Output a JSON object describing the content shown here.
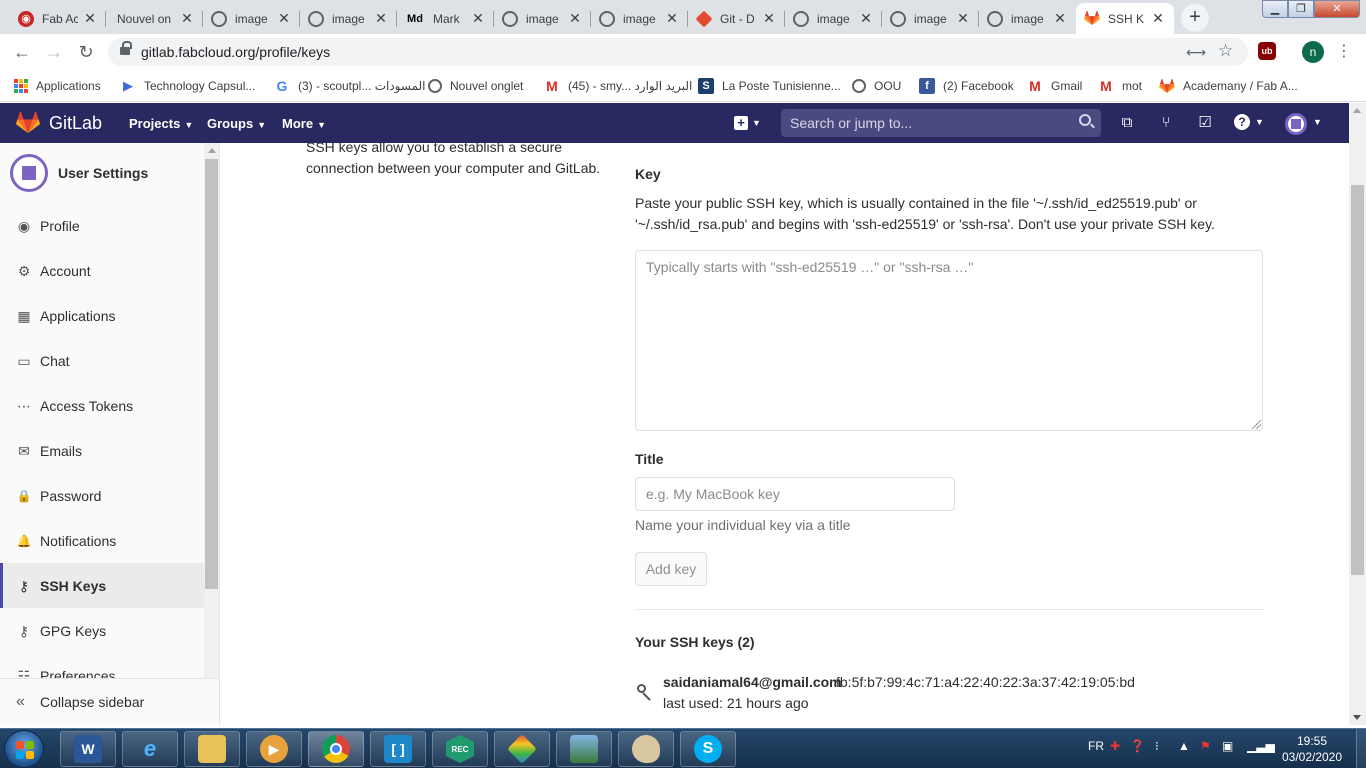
{
  "browser": {
    "tabs": [
      {
        "label": "Fab Ac",
        "favicon": "fab-academy-icon"
      },
      {
        "label": "Nouvel on",
        "favicon": "none"
      },
      {
        "label": "image",
        "favicon": "globe-icon"
      },
      {
        "label": "image",
        "favicon": "globe-icon"
      },
      {
        "label": "Mark",
        "favicon": "markdown-icon"
      },
      {
        "label": "image",
        "favicon": "globe-icon"
      },
      {
        "label": "image",
        "favicon": "globe-icon"
      },
      {
        "label": "Git - D",
        "favicon": "git-icon"
      },
      {
        "label": "image",
        "favicon": "globe-icon"
      },
      {
        "label": "image",
        "favicon": "globe-icon"
      },
      {
        "label": "image",
        "favicon": "globe-icon"
      },
      {
        "label": "SSH K",
        "favicon": "gitlab-icon",
        "active": true
      }
    ],
    "url": "gitlab.fabcloud.org/profile/keys",
    "profile_initial": "n",
    "bookmarks": [
      {
        "label": "Applications",
        "icon": "apps-grid-icon"
      },
      {
        "label": "Technology Capsul...",
        "icon": "play-icon"
      },
      {
        "label": "(3) - scoutpl... المسودات",
        "icon": "google-icon"
      },
      {
        "label": "Nouvel onglet",
        "icon": "globe-icon"
      },
      {
        "label": "(45) - smy... البريد الوارد",
        "icon": "gmail-icon"
      },
      {
        "label": "La Poste Tunisienne...",
        "icon": "laposte-icon"
      },
      {
        "label": "OOU",
        "icon": "globe-icon"
      },
      {
        "label": "(2) Facebook",
        "icon": "facebook-icon"
      },
      {
        "label": "Gmail",
        "icon": "gmail-icon"
      },
      {
        "label": "mot",
        "icon": "gmail-icon"
      },
      {
        "label": "Academany / Fab A...",
        "icon": "gitlab-icon"
      }
    ]
  },
  "gitlab": {
    "brand": "GitLab",
    "nav": {
      "projects": "Projects",
      "groups": "Groups",
      "more": "More"
    },
    "search_placeholder": "Search or jump to..."
  },
  "sidebar": {
    "title": "User Settings",
    "items": [
      {
        "label": "Profile",
        "icon": "profile-icon",
        "glyph": "◉"
      },
      {
        "label": "Account",
        "icon": "account-icon",
        "glyph": "⚙"
      },
      {
        "label": "Applications",
        "icon": "applications-icon",
        "glyph": "▦"
      },
      {
        "label": "Chat",
        "icon": "chat-icon",
        "glyph": "▭"
      },
      {
        "label": "Access Tokens",
        "icon": "token-icon",
        "glyph": "⋯"
      },
      {
        "label": "Emails",
        "icon": "mail-icon",
        "glyph": "✉"
      },
      {
        "label": "Password",
        "icon": "lock-icon",
        "glyph": "🔒"
      },
      {
        "label": "Notifications",
        "icon": "bell-icon",
        "glyph": "🔔"
      },
      {
        "label": "SSH Keys",
        "icon": "key-icon",
        "glyph": "⚷",
        "active": true
      },
      {
        "label": "GPG Keys",
        "icon": "key-icon",
        "glyph": "⚷"
      },
      {
        "label": "Preferences",
        "icon": "preferences-icon",
        "glyph": "☷"
      }
    ],
    "collapse": "Collapse sidebar"
  },
  "main": {
    "intro": "SSH keys allow you to establish a secure connection between your computer and GitLab.",
    "key_label": "Key",
    "key_help": "Paste your public SSH key, which is usually contained in the file '~/.ssh/id_ed25519.pub' or '~/.ssh/id_rsa.pub' and begins with 'ssh-ed25519' or 'ssh-rsa'. Don't use your private SSH key.",
    "key_placeholder": "Typically starts with \"ssh-ed25519 …\" or \"ssh-rsa …\"",
    "title_label": "Title",
    "title_placeholder": "e.g. My MacBook key",
    "title_help": "Name your individual key via a title",
    "add_button": "Add key",
    "keys_heading": "Your SSH keys (2)",
    "keys": [
      {
        "email": "saidaniamal64@gmail.com",
        "fingerprint": "fb:5f:b7:99:4c:71:a4:22:40:22:3a:37:42:19:05:bd",
        "last_used": "last used: 21 hours ago"
      }
    ]
  },
  "taskbar": {
    "lang": "FR",
    "time": "19:55",
    "date": "03/02/2020"
  }
}
